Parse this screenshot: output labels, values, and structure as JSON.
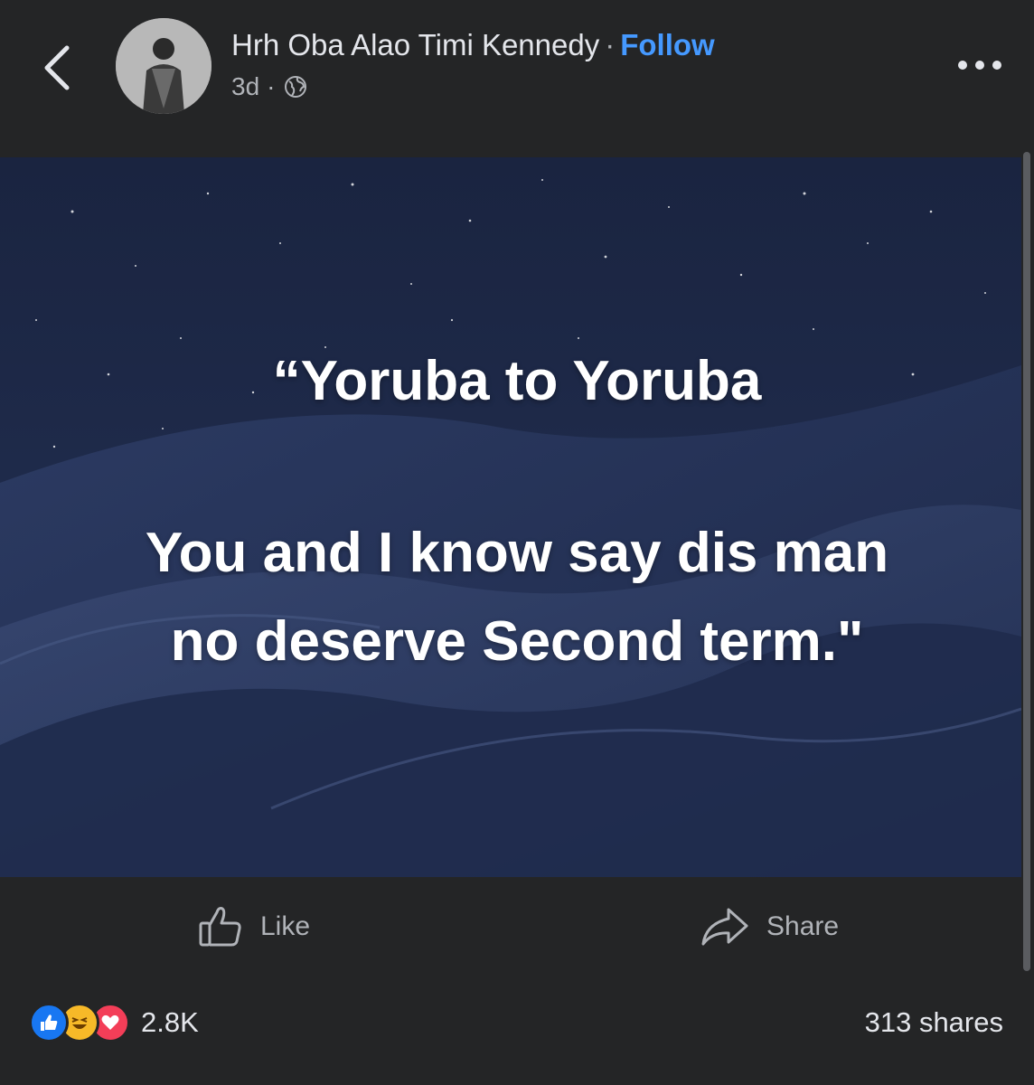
{
  "header": {
    "author_name": "Hrh Oba Alao Timi Kennedy",
    "separator": "·",
    "follow_label": "Follow",
    "time": "3d",
    "meta_separator": "·",
    "privacy_icon": "globe-icon",
    "back_icon": "chevron-left-icon",
    "more_icon": "more-horizontal-icon"
  },
  "post": {
    "lines": [
      "“Yoruba to Yoruba",
      "You and I know say dis man",
      "no deserve Second term.\""
    ]
  },
  "actions": {
    "like_label": "Like",
    "like_icon": "thumbs-up-icon",
    "share_label": "Share",
    "share_icon": "share-arrow-icon"
  },
  "stats": {
    "reactions": [
      "like-reaction-icon",
      "haha-reaction-icon",
      "love-reaction-icon"
    ],
    "reaction_count": "2.8K",
    "shares": "313 shares"
  },
  "colors": {
    "background": "#242526",
    "follow_link": "#4599ff",
    "secondary_text": "#b0b3b8",
    "like_reaction": "#1877f2",
    "haha_reaction": "#f7b928",
    "love_reaction": "#f33e58"
  }
}
